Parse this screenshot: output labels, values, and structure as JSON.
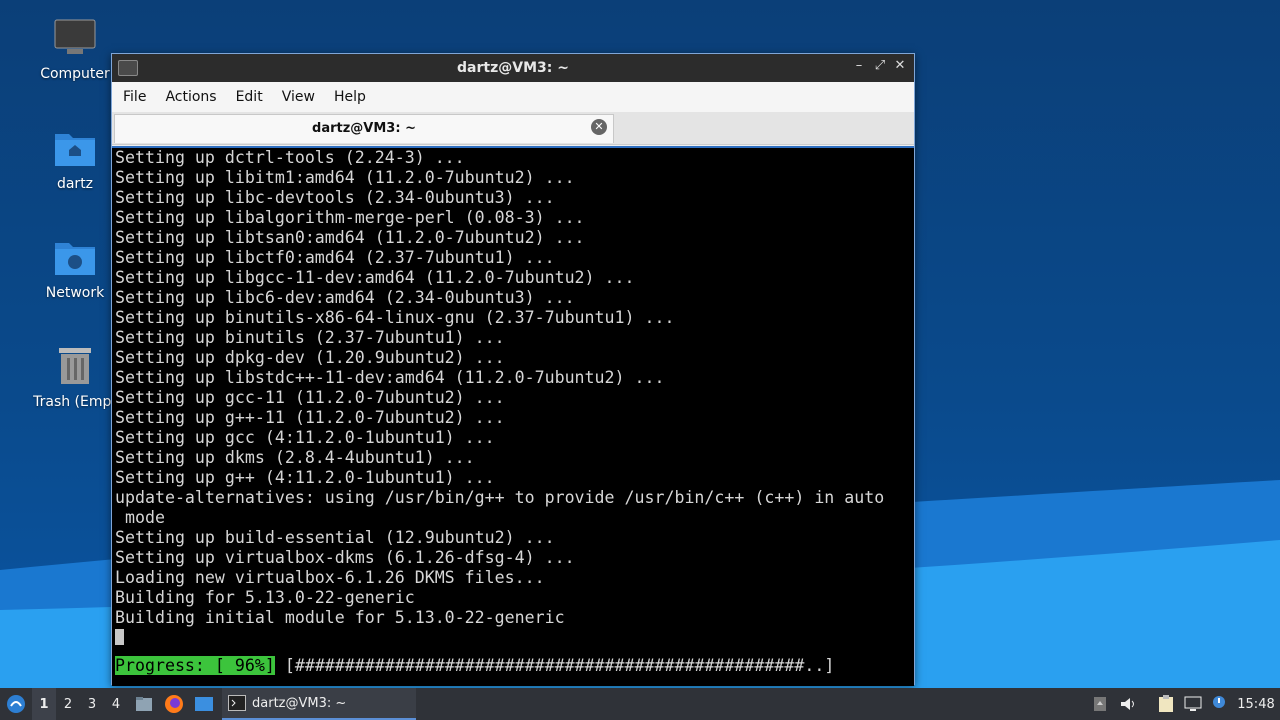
{
  "desktop": {
    "icons": [
      {
        "label": "Computer"
      },
      {
        "label": "dartz"
      },
      {
        "label": "Network"
      },
      {
        "label": "Trash (Empt"
      }
    ]
  },
  "window": {
    "title": "dartz@VM3: ~",
    "menu": [
      "File",
      "Actions",
      "Edit",
      "View",
      "Help"
    ],
    "tab_label": "dartz@VM3: ~",
    "terminal_lines": [
      "Setting up dctrl-tools (2.24-3) ...",
      "Setting up libitm1:amd64 (11.2.0-7ubuntu2) ...",
      "Setting up libc-devtools (2.34-0ubuntu3) ...",
      "Setting up libalgorithm-merge-perl (0.08-3) ...",
      "Setting up libtsan0:amd64 (11.2.0-7ubuntu2) ...",
      "Setting up libctf0:amd64 (2.37-7ubuntu1) ...",
      "Setting up libgcc-11-dev:amd64 (11.2.0-7ubuntu2) ...",
      "Setting up libc6-dev:amd64 (2.34-0ubuntu3) ...",
      "Setting up binutils-x86-64-linux-gnu (2.37-7ubuntu1) ...",
      "Setting up binutils (2.37-7ubuntu1) ...",
      "Setting up dpkg-dev (1.20.9ubuntu2) ...",
      "Setting up libstdc++-11-dev:amd64 (11.2.0-7ubuntu2) ...",
      "Setting up gcc-11 (11.2.0-7ubuntu2) ...",
      "Setting up g++-11 (11.2.0-7ubuntu2) ...",
      "Setting up gcc (4:11.2.0-1ubuntu1) ...",
      "Setting up dkms (2.8.4-4ubuntu1) ...",
      "Setting up g++ (4:11.2.0-1ubuntu1) ...",
      "update-alternatives: using /usr/bin/g++ to provide /usr/bin/c++ (c++) in auto",
      " mode",
      "Setting up build-essential (12.9ubuntu2) ...",
      "Setting up virtualbox-dkms (6.1.26-dfsg-4) ...",
      "Loading new virtualbox-6.1.26 DKMS files...",
      "Building for 5.13.0-22-generic",
      "Building initial module for 5.13.0-22-generic"
    ],
    "progress_label": "Progress: [ 96%]",
    "progress_bar": " [###################################################..]"
  },
  "taskbar": {
    "workspaces": [
      "1",
      "2",
      "3",
      "4"
    ],
    "task_label": "dartz@VM3: ~",
    "clock": "15:48"
  }
}
